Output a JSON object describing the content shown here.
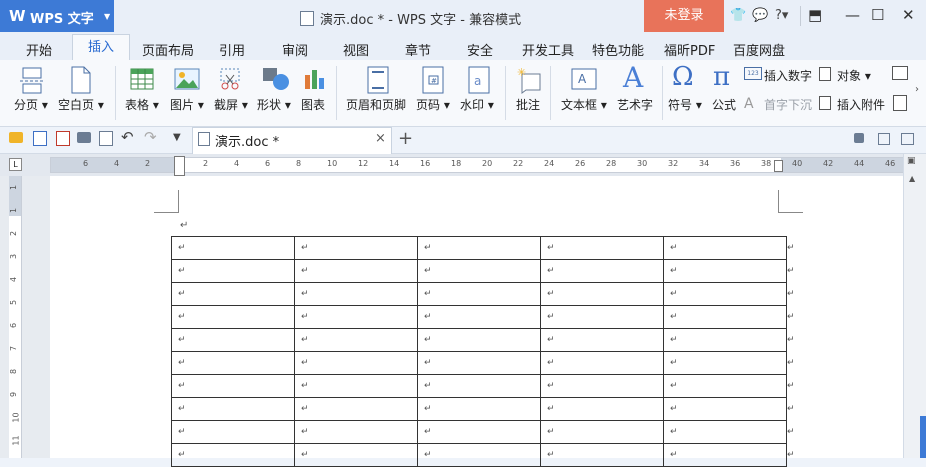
{
  "app": {
    "logo": "W",
    "name": "WPS 文字"
  },
  "title_bar": {
    "document_title": "演示.doc * - WPS 文字 - 兼容模式",
    "login_label": "未登录",
    "help_label": "?"
  },
  "menu_tabs": [
    "开始",
    "插入",
    "页面布局",
    "引用",
    "审阅",
    "视图",
    "章节",
    "安全",
    "开发工具",
    "特色功能",
    "福昕PDF",
    "百度网盘"
  ],
  "ribbon": {
    "page_break": "分页",
    "blank_page": "空白页",
    "table": "表格",
    "picture": "图片",
    "screenshot": "截屏",
    "shapes": "形状",
    "chart": "图表",
    "header_footer": "页眉和页脚",
    "page_number": "页码",
    "watermark": "水印",
    "comment": "批注",
    "textbox": "文本框",
    "wordart": "艺术字",
    "symbol": "符号",
    "formula": "公式",
    "insert_number": "插入数字",
    "insert_number_badge": "123",
    "drop_cap": "首字下沉",
    "object": "对象",
    "insert_attachment": "插入附件"
  },
  "doc_tab": {
    "label": "演示.doc *",
    "close": "×",
    "new_tab": "+"
  },
  "ruler": {
    "left_marks": [
      "6",
      "4",
      "2"
    ],
    "right_marks": [
      "2",
      "4",
      "6",
      "8",
      "10",
      "12",
      "14",
      "16",
      "18",
      "20",
      "22",
      "24",
      "26",
      "28",
      "30",
      "32",
      "34",
      "36",
      "38",
      "40",
      "42",
      "44",
      "46"
    ],
    "vertical_marks": [
      "1",
      "1",
      "2",
      "3",
      "4",
      "5",
      "6",
      "7",
      "8",
      "9",
      "10",
      "11"
    ]
  },
  "document": {
    "paragraph_mark": "↵",
    "table": {
      "rows": 10,
      "cols": 5,
      "cell_mark": "↵"
    }
  }
}
